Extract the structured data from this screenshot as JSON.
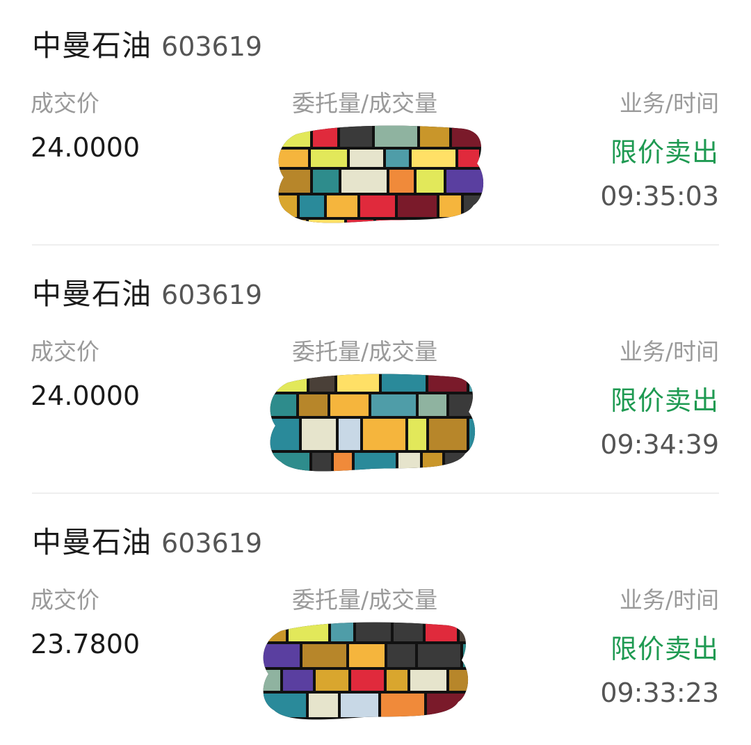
{
  "columns": {
    "price": "成交价",
    "quantity": "委托量/成交量",
    "business_time": "业务/时间"
  },
  "records": [
    {
      "name": "中曼石油",
      "code": "603619",
      "price": "24.0000",
      "business": "限价卖出",
      "time": "09:35:03"
    },
    {
      "name": "中曼石油",
      "code": "603619",
      "price": "24.0000",
      "business": "限价卖出",
      "time": "09:34:39"
    },
    {
      "name": "中曼石油",
      "code": "603619",
      "price": "23.7800",
      "business": "限价卖出",
      "time": "09:33:23"
    }
  ],
  "colors": {
    "business_green": "#1f9a52",
    "label_gray": "#9a9a9a",
    "text_dark": "#1a1a1a"
  }
}
